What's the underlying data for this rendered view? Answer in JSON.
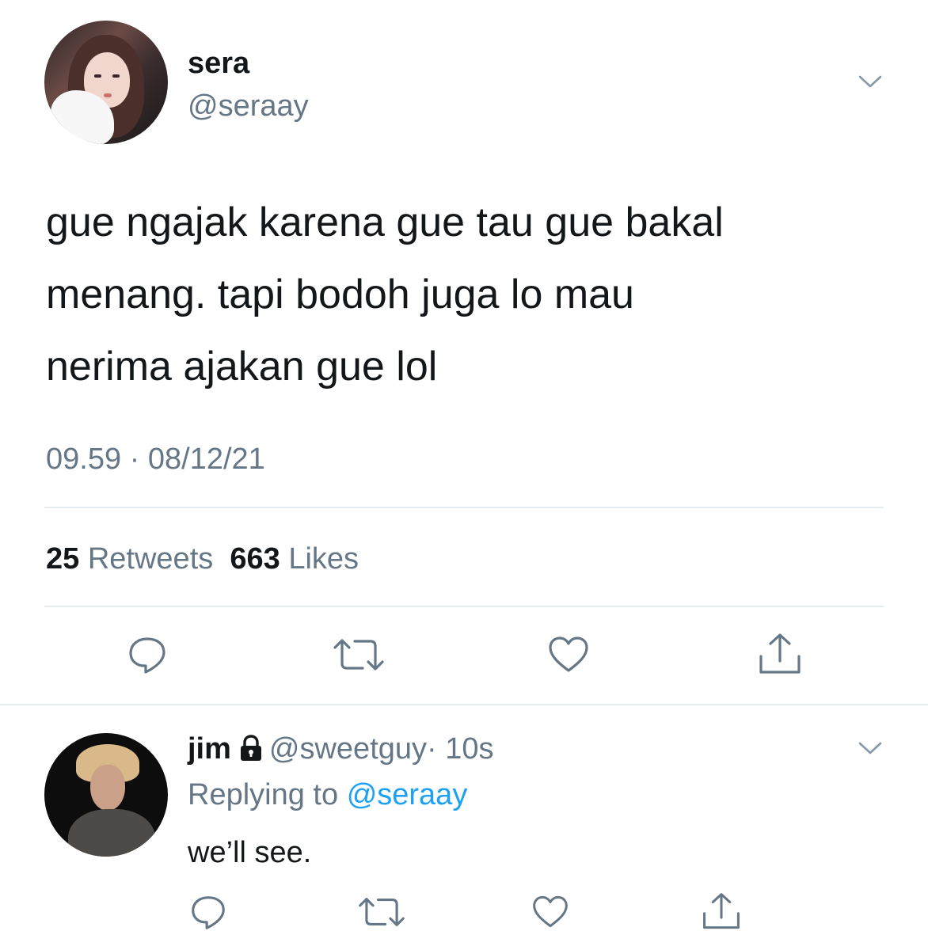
{
  "tweet": {
    "author": {
      "name": "sera",
      "handle": "@seraay"
    },
    "text_lines": [
      "gue ngajak karena gue tau gue bakal",
      "menang. tapi bodoh juga lo mau",
      "nerima ajakan gue lol"
    ],
    "timestamp": "09.59 · 08/12/21",
    "stats": {
      "retweets_count": "25",
      "retweets_label": "Retweets",
      "likes_count": "663",
      "likes_label": "Likes"
    },
    "actions": [
      "reply-icon",
      "retweet-icon",
      "like-icon",
      "share-icon"
    ]
  },
  "reply": {
    "author": {
      "name": "jim",
      "handle": "@sweetguy",
      "time": "· 10s",
      "protected_icon": "lock-icon"
    },
    "replying_prefix": "Replying to",
    "replying_mention": "@seraay",
    "text": "we’ll see.",
    "actions": [
      "reply-icon",
      "retweet-icon",
      "like-icon",
      "share-icon"
    ]
  },
  "colors": {
    "text_primary": "#14171a",
    "text_secondary": "#657786",
    "link": "#1da1f2",
    "divider": "#e6ecf0"
  }
}
